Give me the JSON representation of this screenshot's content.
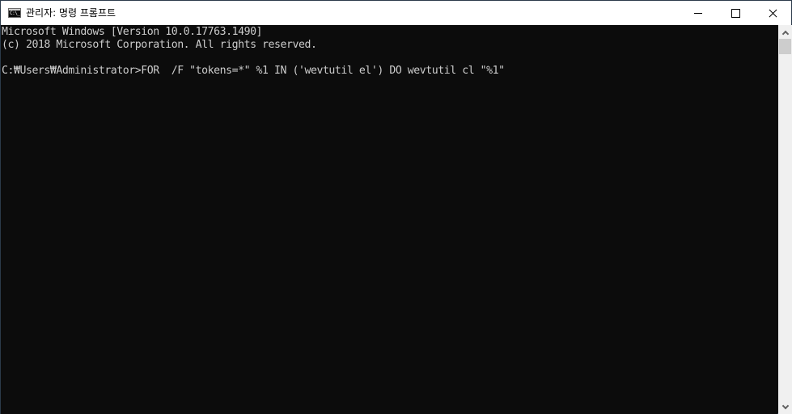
{
  "window": {
    "title": "관리자: 명령 프롬프트",
    "app_icon": "cmd-icon",
    "app_icon_text": "C:\\_",
    "controls": {
      "minimize": "minimize-icon",
      "maximize": "maximize-icon",
      "close": "close-icon"
    }
  },
  "console": {
    "lines": [
      "Microsoft Windows [Version 10.0.17763.1490]",
      "(c) 2018 Microsoft Corporation. All rights reserved.",
      "",
      "C:₩Users₩Administrator>FOR  /F \"tokens=*\" %1 IN ('wevtutil el') DO wevtutil cl \"%1\""
    ],
    "colors": {
      "background": "#0c0c0c",
      "foreground": "#cccccc"
    }
  },
  "scrollbar": {
    "up_icon": "chevron-up-icon",
    "down_icon": "chevron-down-icon"
  }
}
